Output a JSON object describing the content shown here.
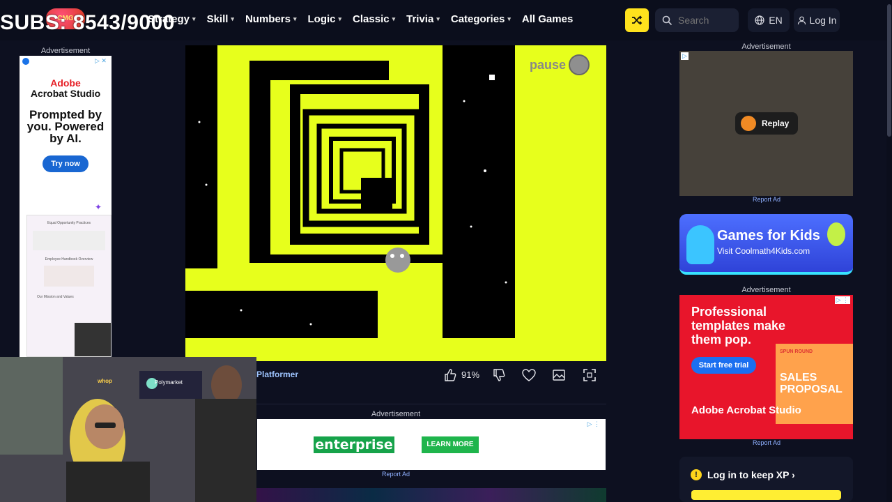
{
  "overlay": {
    "subs": "SUBS: 8543/9000"
  },
  "header": {
    "logo": "Coolmath Games",
    "nav": [
      {
        "label": "Strategy"
      },
      {
        "label": "Skill"
      },
      {
        "label": "Numbers"
      },
      {
        "label": "Logic"
      },
      {
        "label": "Classic"
      },
      {
        "label": "Trivia"
      },
      {
        "label": "Categories"
      },
      {
        "label": "All Games"
      }
    ],
    "search_placeholder": "Search",
    "lang": "EN",
    "login": "Log In"
  },
  "ads": {
    "label": "Advertisement",
    "report": "Report Ad",
    "left": {
      "brand_line1": "Adobe",
      "brand_line2": "Acrobat Studio",
      "headline": "Prompted by you. Powered by AI.",
      "cta": "Try now",
      "doc_title": "Equal Opportunity Practices",
      "doc_sub": "Employee Handbook Overview",
      "doc_sub2": "Our Mission and Values"
    },
    "middle": {
      "brand": "enterprise",
      "cta": "LEARN MORE"
    },
    "right_top": {
      "replay": "Replay"
    },
    "right_bottom": {
      "headline": "Professional templates make them pop.",
      "cta": "Start free trial",
      "card_title": "SALES PROPOSAL",
      "card_kicker": "SPUN ROUND",
      "brand": "Adobe Acrobat Studio"
    }
  },
  "game": {
    "pause_label": "pause",
    "category": "Platformer",
    "rating": "91%"
  },
  "kids_banner": {
    "title": "Games for Kids",
    "subtitle": "Visit Coolmath4Kids.com"
  },
  "xp": {
    "prompt": "Log in to keep XP"
  },
  "webcam": {
    "sign1": "whop",
    "sign2": "Polymarket"
  },
  "colors": {
    "game_bg": "#e7ff1c",
    "accent": "#ffe21d",
    "page_bg": "#0d1020"
  }
}
